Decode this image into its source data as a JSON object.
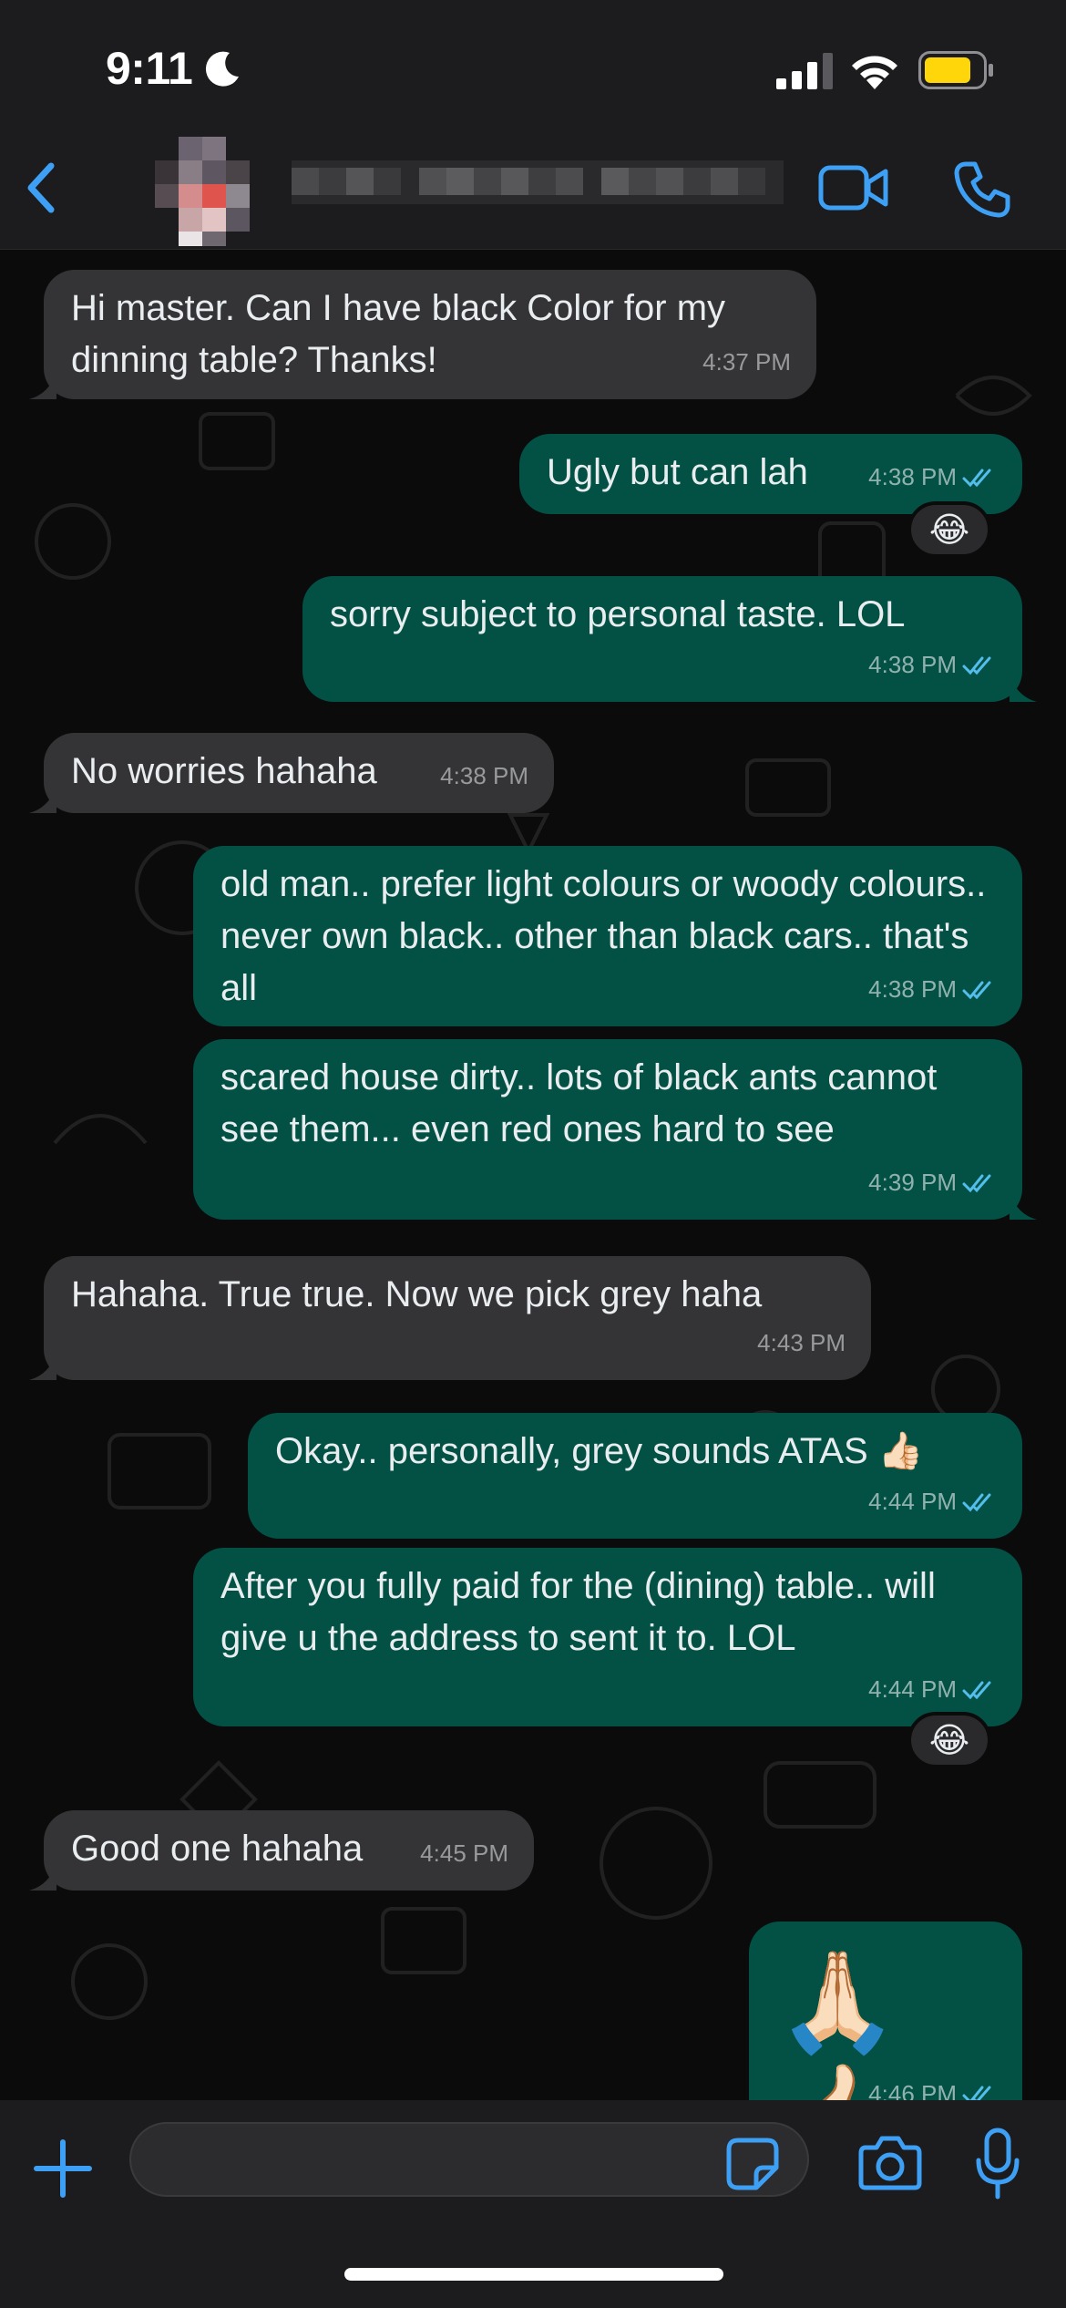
{
  "status_bar": {
    "time": "9:11",
    "focus_icon": "moon-icon",
    "signal_icon": "cellular-signal-icon",
    "wifi_icon": "wifi-icon",
    "battery_icon": "battery-icon",
    "battery_color": "#ffd60a"
  },
  "header": {
    "back_icon": "chevron-left-icon",
    "contact_name": "",
    "avatar": "blurred-avatar",
    "video_call_icon": "video-camera-icon",
    "voice_call_icon": "phone-icon",
    "accent_color": "#3ea0f5"
  },
  "colors": {
    "incoming_bubble": "#343436",
    "outgoing_bubble": "#025144",
    "read_tick": "#53bdeb",
    "background": "#0b0b0c"
  },
  "messages": [
    {
      "direction": "in",
      "text": "Hi master. Can I have black Color for my dinning table? Thanks!",
      "time": "4:37 PM"
    },
    {
      "direction": "out",
      "text": "Ugly but can lah",
      "time": "4:38 PM",
      "status": "read",
      "reaction": "😂"
    },
    {
      "direction": "out",
      "text": "sorry subject to personal taste. LOL",
      "time": "4:38 PM",
      "status": "read"
    },
    {
      "direction": "in",
      "text": "No worries hahaha",
      "time": "4:38 PM"
    },
    {
      "direction": "out",
      "text": "old man.. prefer light colours or woody colours.. never own black.. other than black cars.. that's all",
      "time": "4:38 PM",
      "status": "read"
    },
    {
      "direction": "out",
      "text": "scared house dirty.. lots of black ants cannot see them... even red ones hard to see",
      "time": "4:39 PM",
      "status": "read"
    },
    {
      "direction": "in",
      "text": "Hahaha. True true. Now we pick grey haha",
      "time": "4:43 PM"
    },
    {
      "direction": "out",
      "text": "Okay.. personally, grey sounds ATAS 👍🏻",
      "time": "4:44 PM",
      "status": "read"
    },
    {
      "direction": "out",
      "text": "After you fully paid for the (dining) table.. will give u the address to sent it to. LOL",
      "time": "4:44 PM",
      "status": "read",
      "reaction": "😂"
    },
    {
      "direction": "in",
      "text": "Good one hahaha",
      "time": "4:45 PM"
    },
    {
      "direction": "out",
      "text": "🙏🏻👍🏻",
      "time": "4:46 PM",
      "status": "read"
    }
  ],
  "input_bar": {
    "attach_icon": "plus-icon",
    "placeholder": "",
    "value": "",
    "sticker_icon": "sticker-icon",
    "camera_icon": "camera-icon",
    "mic_icon": "microphone-icon"
  }
}
